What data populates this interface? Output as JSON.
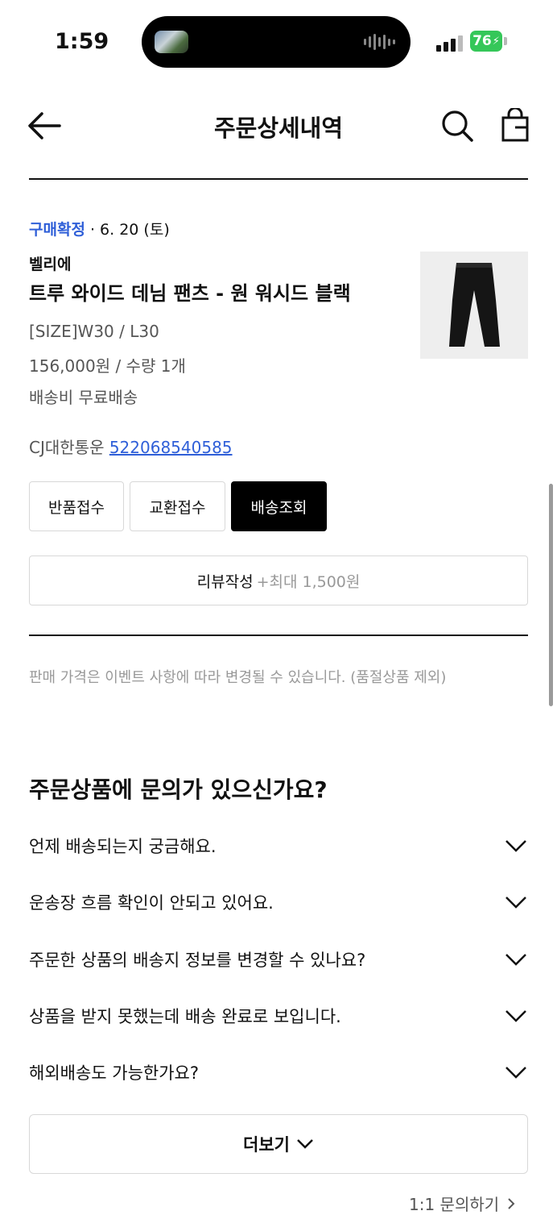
{
  "status_bar": {
    "time": "1:59",
    "battery": "76"
  },
  "header": {
    "title": "주문상세내역"
  },
  "order": {
    "status": "구매확정",
    "date": "· 6. 20 (토)",
    "brand": "벨리에",
    "product_name": "트루 와이드 데님 팬츠 - 원 워시드 블랙",
    "size": "[SIZE]W30 / L30",
    "price_qty": "156,000원 / 수량 1개",
    "shipping_fee": "배송비 무료배송",
    "courier": "CJ대한통운",
    "tracking_number": "522068540585"
  },
  "actions": {
    "return": "반품접수",
    "exchange": "교환접수",
    "track": "배송조회"
  },
  "review": {
    "label": "리뷰작성",
    "reward": "+최대 1,500원"
  },
  "notice": "판매 가격은 이벤트 사항에 따라 변경될 수 있습니다. (품절상품 제외)",
  "faq": {
    "title": "주문상품에 문의가 있으신가요?",
    "items": [
      "언제 배송되는지 궁금해요.",
      "운송장 흐름 확인이 안되고 있어요.",
      "주문한 상품의 배송지 정보를 변경할 수 있나요?",
      "상품을 받지 못했는데 배송 완료로 보입니다.",
      "해외배송도 가능한가요?"
    ],
    "more": "더보기",
    "inquiry": "1:1 문의하기"
  }
}
